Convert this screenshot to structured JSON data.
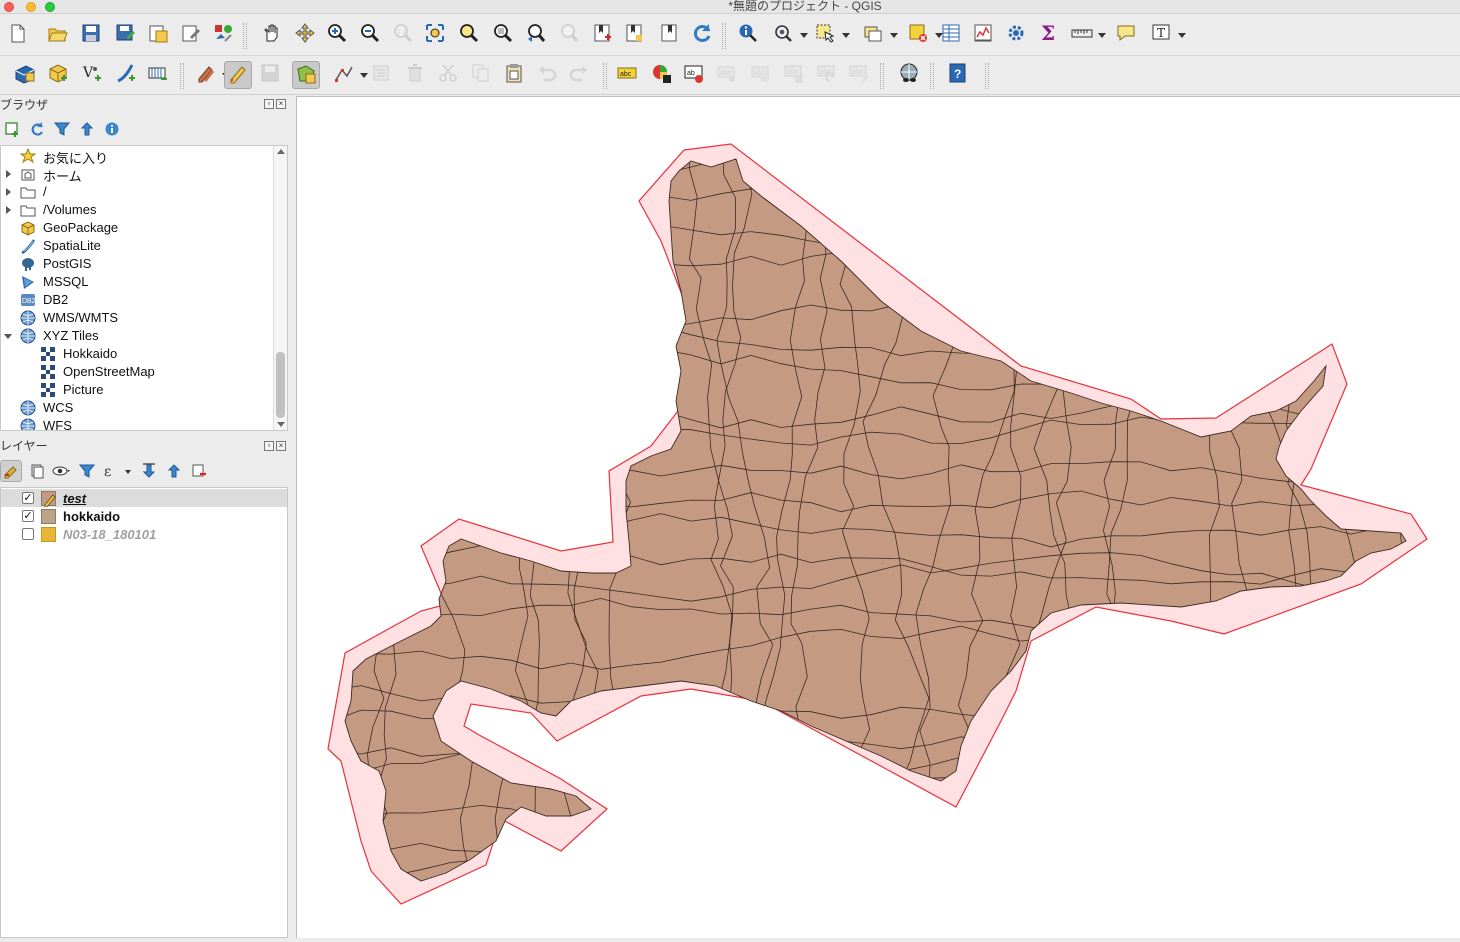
{
  "window": {
    "title": "*無題のプロジェクト - QGIS"
  },
  "toolbar1": {
    "items": [
      {
        "name": "new-project-icon"
      },
      {
        "name": "open-project-icon"
      },
      {
        "name": "save-project-icon"
      },
      {
        "name": "save-as-icon"
      },
      {
        "name": "new-print-layout-icon"
      },
      {
        "name": "layout-manager-icon"
      },
      {
        "name": "style-manager-icon"
      },
      {
        "name": "pan-icon"
      },
      {
        "name": "pan-to-selection-icon"
      },
      {
        "name": "zoom-in-icon"
      },
      {
        "name": "zoom-out-icon"
      },
      {
        "name": "zoom-native-icon"
      },
      {
        "name": "zoom-full-icon"
      },
      {
        "name": "zoom-to-selection-icon"
      },
      {
        "name": "zoom-to-layer-icon"
      },
      {
        "name": "zoom-last-icon"
      },
      {
        "name": "zoom-next-icon"
      },
      {
        "name": "new-bookmark-icon"
      },
      {
        "name": "show-bookmarks-icon"
      },
      {
        "name": "temporal-controller-icon"
      },
      {
        "name": "refresh-icon"
      },
      {
        "name": "identify-icon"
      },
      {
        "name": "run-action-icon"
      },
      {
        "name": "select-features-icon"
      },
      {
        "name": "select-by-value-icon"
      },
      {
        "name": "deselect-icon"
      },
      {
        "name": "attribute-table-icon"
      },
      {
        "name": "field-calculator-icon"
      },
      {
        "name": "processing-toolbox-icon"
      },
      {
        "name": "statistical-summary-icon"
      },
      {
        "name": "measure-icon"
      },
      {
        "name": "map-tips-icon"
      },
      {
        "name": "text-annotation-icon"
      }
    ]
  },
  "toolbar2": {
    "items": [
      {
        "name": "data-source-manager-icon"
      },
      {
        "name": "new-geopackage-layer-icon"
      },
      {
        "name": "new-shapefile-layer-icon"
      },
      {
        "name": "new-spatialite-layer-icon"
      },
      {
        "name": "new-virtual-layer-icon"
      },
      {
        "name": "current-edits-icon"
      },
      {
        "name": "toggle-editing-icon"
      },
      {
        "name": "save-edits-icon"
      },
      {
        "name": "add-polygon-icon"
      },
      {
        "name": "vertex-tool-icon"
      },
      {
        "name": "modify-attributes-icon"
      },
      {
        "name": "delete-selected-icon"
      },
      {
        "name": "cut-features-icon"
      },
      {
        "name": "copy-features-icon"
      },
      {
        "name": "paste-features-icon"
      },
      {
        "name": "undo-icon"
      },
      {
        "name": "redo-icon"
      },
      {
        "name": "label-tool-icon"
      },
      {
        "name": "diagram-tool-icon"
      },
      {
        "name": "pin-labels-icon"
      },
      {
        "name": "highlight-pinned-icon"
      },
      {
        "name": "show-hide-labels-icon"
      },
      {
        "name": "move-label-icon"
      },
      {
        "name": "rotate-label-icon"
      },
      {
        "name": "change-label-icon"
      },
      {
        "name": "quickosm-icon"
      },
      {
        "name": "help-icon"
      }
    ]
  },
  "browser": {
    "title": "ブラウザ",
    "items": [
      {
        "label": "お気に入り",
        "icon": "star-icon",
        "arrow": "",
        "indent": 0
      },
      {
        "label": "ホーム",
        "icon": "home-folder-icon",
        "arrow": "right",
        "indent": 0
      },
      {
        "label": "/",
        "icon": "folder-icon",
        "arrow": "right",
        "indent": 0
      },
      {
        "label": "/Volumes",
        "icon": "folder-icon",
        "arrow": "right",
        "indent": 0
      },
      {
        "label": "GeoPackage",
        "icon": "geopackage-icon",
        "arrow": "",
        "indent": 0
      },
      {
        "label": "SpatiaLite",
        "icon": "spatialite-icon",
        "arrow": "",
        "indent": 0
      },
      {
        "label": "PostGIS",
        "icon": "postgis-icon",
        "arrow": "",
        "indent": 0
      },
      {
        "label": "MSSQL",
        "icon": "mssql-icon",
        "arrow": "",
        "indent": 0
      },
      {
        "label": "DB2",
        "icon": "db2-icon",
        "arrow": "",
        "indent": 0
      },
      {
        "label": "WMS/WMTS",
        "icon": "globe-icon",
        "arrow": "",
        "indent": 0
      },
      {
        "label": "XYZ Tiles",
        "icon": "globe-icon",
        "arrow": "down",
        "indent": 0
      },
      {
        "label": "Hokkaido",
        "icon": "xyz-tile-icon",
        "arrow": "",
        "indent": 1
      },
      {
        "label": "OpenStreetMap",
        "icon": "xyz-tile-icon",
        "arrow": "",
        "indent": 1
      },
      {
        "label": "Picture",
        "icon": "xyz-tile-icon",
        "arrow": "",
        "indent": 1
      },
      {
        "label": "WCS",
        "icon": "globe-icon",
        "arrow": "",
        "indent": 0
      },
      {
        "label": "WFS",
        "icon": "globe-icon",
        "arrow": "",
        "indent": 0
      }
    ]
  },
  "layers_panel": {
    "title": "レイヤー",
    "layers": [
      {
        "label": "test",
        "checked": true,
        "selected": true,
        "editing": true,
        "color": "#c49a82",
        "greyed": false
      },
      {
        "label": "hokkaido",
        "checked": true,
        "selected": false,
        "editing": false,
        "color": "#bca489",
        "greyed": false
      },
      {
        "label": "N03-18_180101",
        "checked": false,
        "selected": false,
        "editing": false,
        "color": "#e8b53a",
        "greyed": true
      }
    ]
  },
  "map": {
    "land_fill": "#c49a82",
    "land_stroke": "#3c2a22",
    "buffer_fill": "#ffe1e3",
    "buffer_stroke": "#e8323c"
  }
}
